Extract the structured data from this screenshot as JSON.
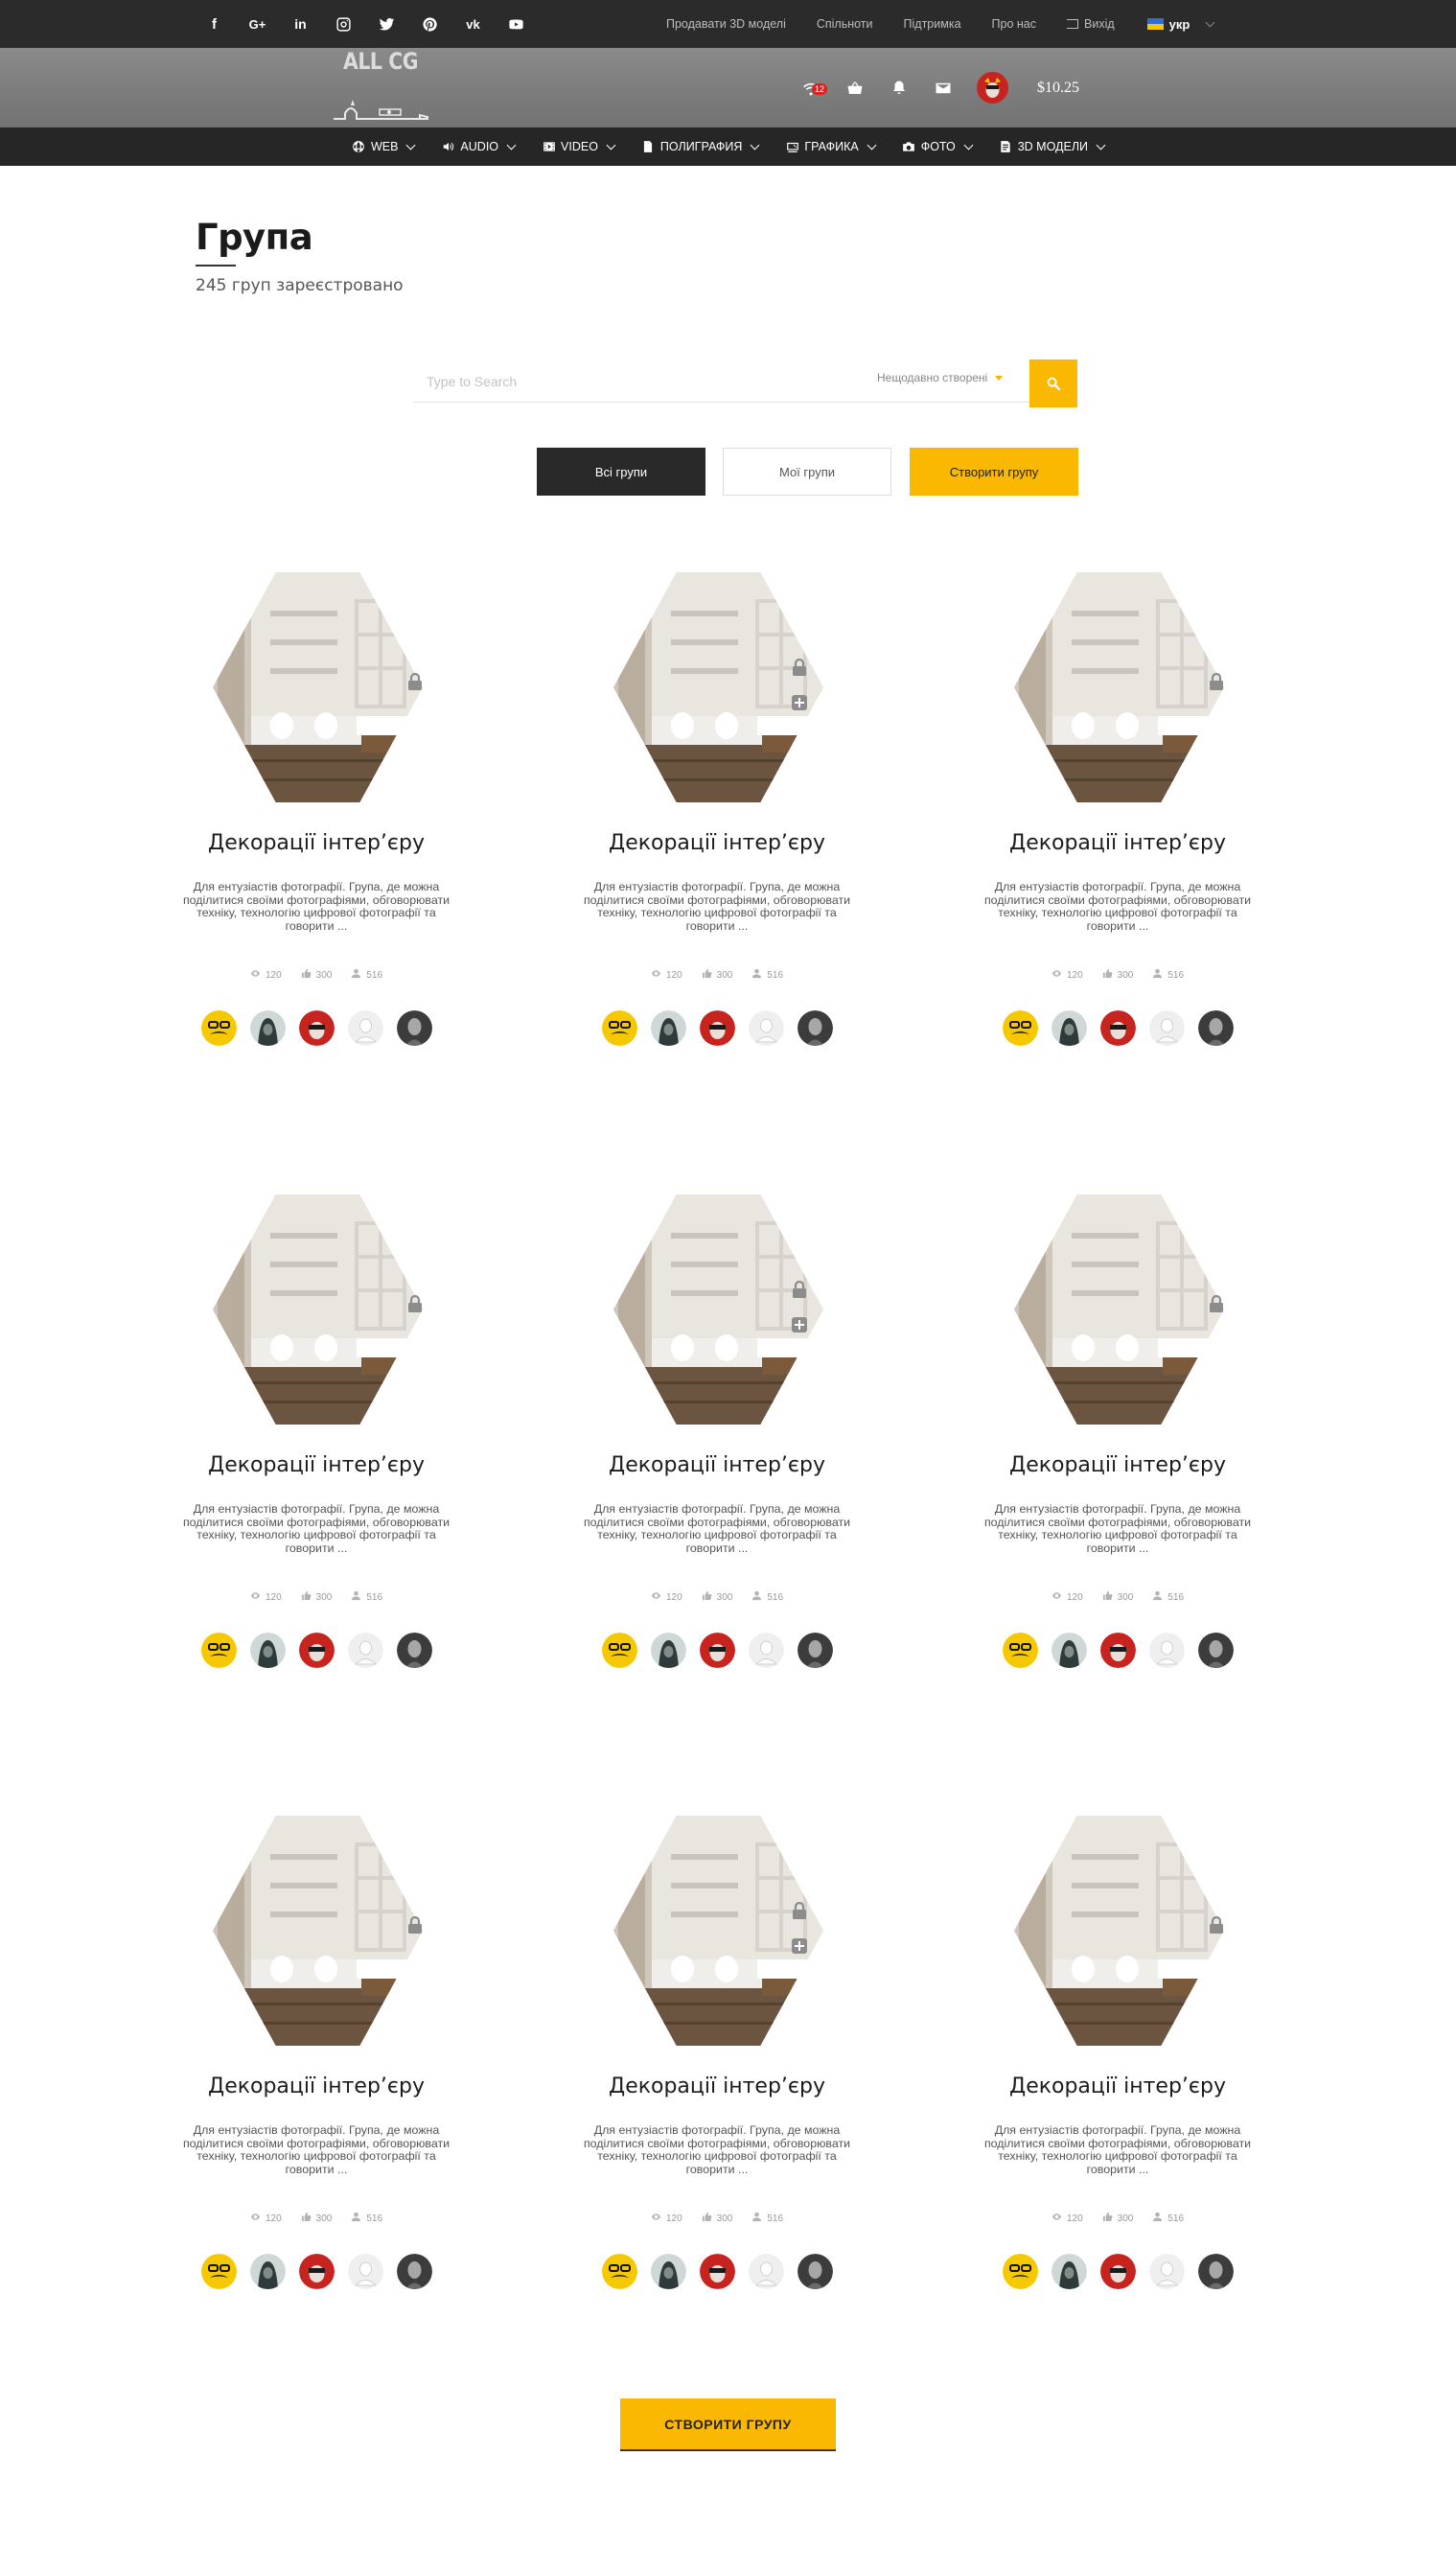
{
  "topbar": {
    "social": [
      {
        "name": "facebook-icon",
        "glyph": "f"
      },
      {
        "name": "google-plus-icon",
        "glyph": "G+"
      },
      {
        "name": "linkedin-icon",
        "glyph": "in"
      },
      {
        "name": "instagram-icon",
        "glyph": ""
      },
      {
        "name": "twitter-icon",
        "glyph": ""
      },
      {
        "name": "pinterest-icon",
        "glyph": ""
      },
      {
        "name": "vk-icon",
        "glyph": "vk"
      },
      {
        "name": "youtube-icon",
        "glyph": ""
      }
    ],
    "links": [
      "Продавати 3D моделі",
      "Спільноти",
      "Підтримка",
      "Про нас"
    ],
    "logout_label": "Вихід",
    "language": "укр"
  },
  "header": {
    "logo_text": "ALL CG",
    "notifications_count": "12",
    "balance": "$10.25"
  },
  "categories": [
    {
      "label": "WEB",
      "icon": "globe-icon"
    },
    {
      "label": "AUDIO",
      "icon": "speaker-icon"
    },
    {
      "label": "VIDEO",
      "icon": "video-icon"
    },
    {
      "label": "ПОЛИГРАФИЯ",
      "icon": "document-icon"
    },
    {
      "label": "ГРАФИКА",
      "icon": "graphics-icon"
    },
    {
      "label": "ФОТО",
      "icon": "camera-icon"
    },
    {
      "label": "3D МОДЕЛИ",
      "icon": "cube-icon"
    }
  ],
  "page": {
    "title": "Група",
    "subtitle": "245 груп зареєстровано"
  },
  "search": {
    "placeholder": "Type to Search",
    "sort_value": "Нещодавно створені"
  },
  "tabs": {
    "all": "Всі групи",
    "mine": "Мої групи",
    "create": "Створити групу"
  },
  "groups": [
    {
      "title": "Декорації інтер’єру",
      "desc": "Для ентузіастів фотографії. Група, де можна поділитися своїми фотографіями, обговорювати техніку, технологію цифрової фотографії та говорити ...",
      "views": "120",
      "likes": "300",
      "members": "516",
      "joinable": false
    },
    {
      "title": "Декорації інтер’єру",
      "desc": "Для ентузіастів фотографії. Група, де можна поділитися своїми фотографіями, обговорювати техніку, технологію цифрової фотографії та говорити ...",
      "views": "120",
      "likes": "300",
      "members": "516",
      "joinable": true
    },
    {
      "title": "Декорації інтер’єру",
      "desc": "Для ентузіастів фотографії. Група, де можна поділитися своїми фотографіями, обговорювати техніку, технологію цифрової фотографії та говорити ...",
      "views": "120",
      "likes": "300",
      "members": "516",
      "joinable": false
    },
    {
      "title": "Декорації інтер’єру",
      "desc": "Для ентузіастів фотографії. Група, де можна поділитися своїми фотографіями, обговорювати техніку, технологію цифрової фотографії та говорити ...",
      "views": "120",
      "likes": "300",
      "members": "516",
      "joinable": false
    },
    {
      "title": "Декорації інтер’єру",
      "desc": "Для ентузіастів фотографії. Група, де можна поділитися своїми фотографіями, обговорювати техніку, технологію цифрової фотографії та говорити ...",
      "views": "120",
      "likes": "300",
      "members": "516",
      "joinable": true
    },
    {
      "title": "Декорації інтер’єру",
      "desc": "Для ентузіастів фотографії. Група, де можна поділитися своїми фотографіями, обговорювати техніку, технологію цифрової фотографії та говорити ...",
      "views": "120",
      "likes": "300",
      "members": "516",
      "joinable": false
    },
    {
      "title": "Декорації інтер’єру",
      "desc": "Для ентузіастів фотографії. Група, де можна поділитися своїми фотографіями, обговорювати техніку, технологію цифрової фотографії та говорити ...",
      "views": "120",
      "likes": "300",
      "members": "516",
      "joinable": false
    },
    {
      "title": "Декорації інтер’єру",
      "desc": "Для ентузіастів фотографії. Група, де можна поділитися своїми фотографіями, обговорювати техніку, технологію цифрової фотографії та говорити ...",
      "views": "120",
      "likes": "300",
      "members": "516",
      "joinable": true
    },
    {
      "title": "Декорації інтер’єру",
      "desc": "Для ентузіастів фотографії. Група, де можна поділитися своїми фотографіями, обговорювати техніку, технологію цифрової фотографії та говорити ...",
      "views": "120",
      "likes": "300",
      "members": "516",
      "joinable": false
    }
  ],
  "member_avatars": [
    "mustache-avatar",
    "hooded-avatar",
    "red-mask-avatar",
    "white-bust-avatar",
    "bw-portrait-avatar"
  ],
  "cta_label": "СТВОРИТИ ГРУПУ",
  "colors": {
    "accent": "#fbb800",
    "topbar": "#2b2b2b",
    "header": "#808080",
    "nav": "#262626"
  }
}
